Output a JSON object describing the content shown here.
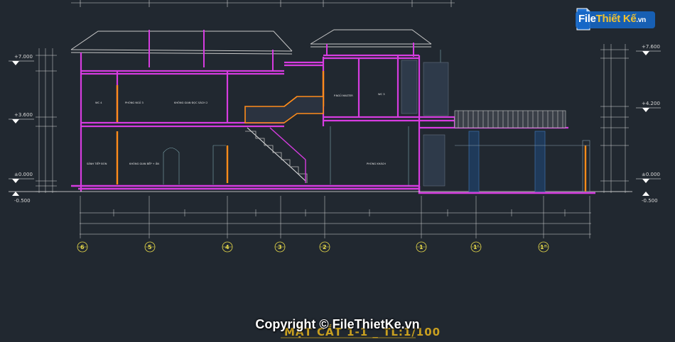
{
  "drawing": {
    "title": "MẶT CẮT 1-1 _ TL:1/100",
    "levels_left": [
      "+7.000",
      "+3.600",
      "±0.000",
      "-0.500"
    ],
    "levels_right": [
      "+7.600",
      "+4.200",
      "±0.000",
      "-0.500"
    ],
    "axes": [
      "6",
      "5",
      "4",
      "3",
      "2",
      "1",
      "1'",
      "1\""
    ],
    "rooms": [
      "WC 4",
      "PHÒNG NGỦ 3",
      "KHÔNG GIAN ĐỌC SÁCH 2",
      "P.NGỦ MASTER",
      "WC 3",
      "SẢNH TIẾP ĐÓN",
      "KHÔNG GIAN BẾP + ĂN",
      "PHÒNG KHÁCH"
    ],
    "colors": {
      "background": "#212830",
      "section_cut": "#d63ce0",
      "wall_orange": "#ff8c1a",
      "dimension": "#e0e0e0",
      "axis_bubble": "#e6d84a",
      "roof": "#c7c7c7",
      "ground_line": "#e8e8e8"
    }
  },
  "watermark": {
    "logo_part1": "File",
    "logo_part2": "Thiết Kế",
    "logo_domain": ".vn",
    "copyright": "Copyright © FileThietKe.vn"
  }
}
